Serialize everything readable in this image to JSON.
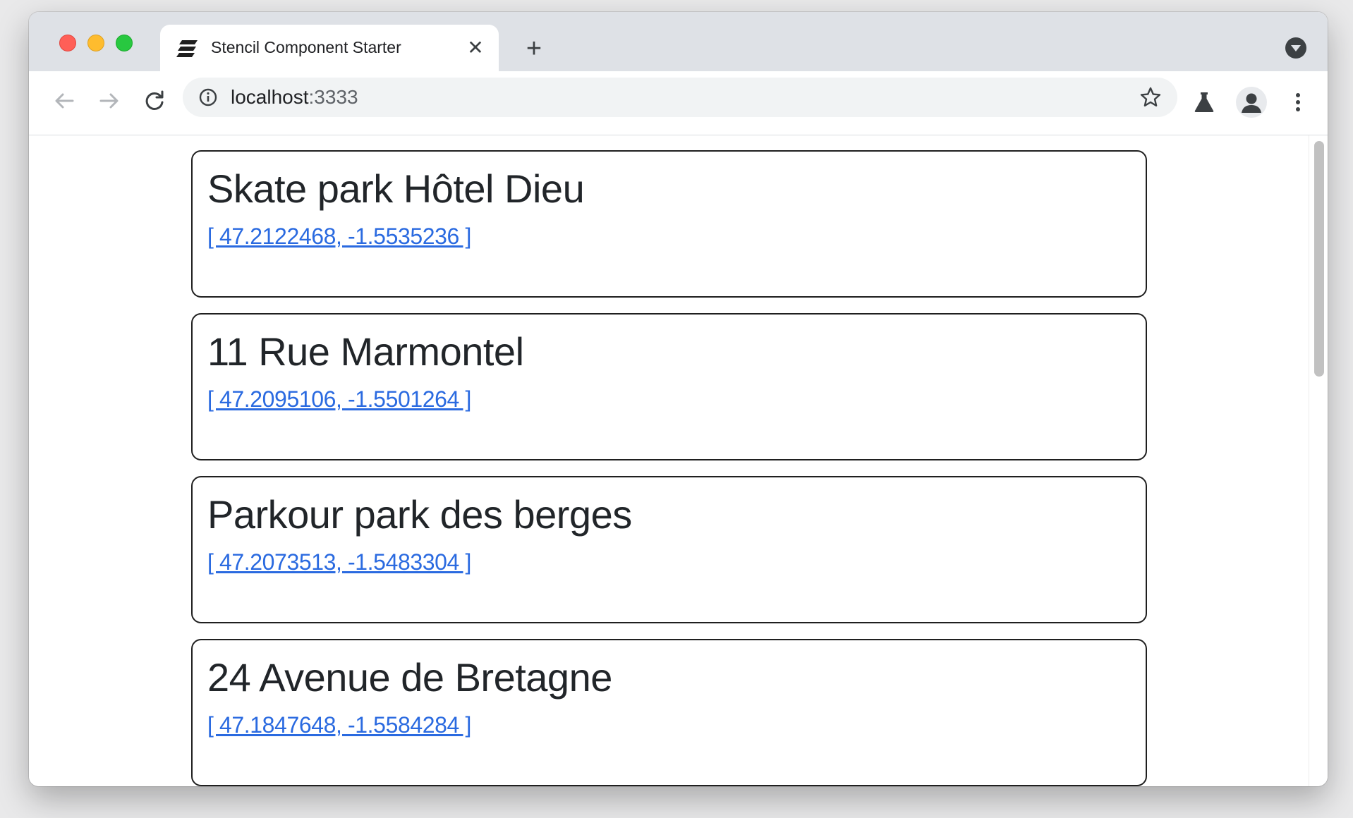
{
  "browser": {
    "tab_title": "Stencil Component Starter",
    "tab_icon": "stencil-logo-icon",
    "url_host": "localhost",
    "url_port": ":3333"
  },
  "places": [
    {
      "name": "Skate park Hôtel Dieu",
      "coords": "[ 47.2122468, -1.5535236 ]"
    },
    {
      "name": "11 Rue Marmontel",
      "coords": "[ 47.2095106, -1.5501264 ]"
    },
    {
      "name": "Parkour park des berges",
      "coords": "[ 47.2073513, -1.5483304 ]"
    },
    {
      "name": "24 Avenue de Bretagne",
      "coords": "[ 47.1847648, -1.5584284 ]"
    }
  ],
  "colors": {
    "link": "#2a6ae0",
    "card_border": "#1f1f1f",
    "title_text": "#212529"
  }
}
